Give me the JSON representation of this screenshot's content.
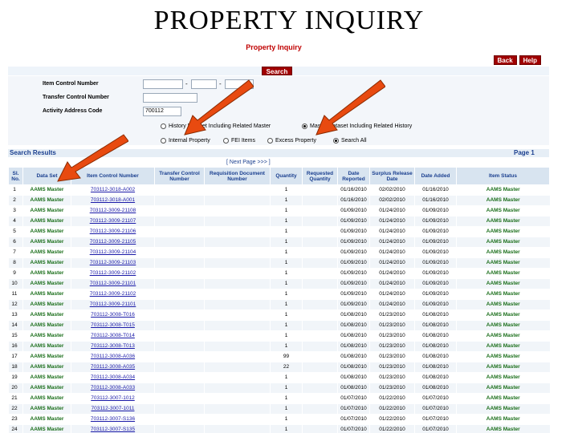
{
  "slide_title": "PROPERTY INQUIRY",
  "page_heading": "Property Inquiry",
  "buttons": {
    "back": "Back",
    "help": "Help",
    "search": "Search"
  },
  "form": {
    "item_control_label": "Item Control Number",
    "transfer_control_label": "Transfer Control Number",
    "aac_label": "Activity Address Code",
    "aac_value": "700112",
    "radio_history": "History Dataset Including Related Master",
    "radio_master": "Master Dataset Including Related History",
    "radio_internal": "Internal Property",
    "radio_fei": "FEI Items",
    "radio_excess": "Excess Property",
    "radio_search_all": "Search All"
  },
  "results": {
    "label": "Search Results",
    "page_label": "Page 1",
    "next_page": "[ Next Page >>> ]",
    "columns": [
      "Sl. No.",
      "Data Set",
      "Item Control Number",
      "Transfer Control Number",
      "Requisition Document Number",
      "Quantity",
      "Requested Quantity",
      "Date Reported",
      "Surplus Release Date",
      "Date Added",
      "Item Status"
    ],
    "rows": [
      {
        "no": "1",
        "ds": "AAMS Master",
        "icn": "703112-3018-A002",
        "qty": "1",
        "rep": "01/16/2010",
        "rel": "02/02/2010",
        "added": "01/16/2010",
        "status": "AAMS Master"
      },
      {
        "no": "2",
        "ds": "AAMS Master",
        "icn": "703112-3018-A001",
        "qty": "1",
        "rep": "01/16/2010",
        "rel": "02/02/2010",
        "added": "01/16/2010",
        "status": "AAMS Master"
      },
      {
        "no": "3",
        "ds": "AAMS Master",
        "icn": "703112-3009-21108",
        "qty": "1",
        "rep": "01/09/2010",
        "rel": "01/24/2010",
        "added": "01/09/2010",
        "status": "AAMS Master"
      },
      {
        "no": "4",
        "ds": "AAMS Master",
        "icn": "703112-3009-21107",
        "qty": "1",
        "rep": "01/09/2010",
        "rel": "01/24/2010",
        "added": "01/09/2010",
        "status": "AAMS Master"
      },
      {
        "no": "5",
        "ds": "AAMS Master",
        "icn": "703112-3009-21106",
        "qty": "1",
        "rep": "01/09/2010",
        "rel": "01/24/2010",
        "added": "01/09/2010",
        "status": "AAMS Master"
      },
      {
        "no": "6",
        "ds": "AAMS Master",
        "icn": "703112-3009-21105",
        "qty": "1",
        "rep": "01/09/2010",
        "rel": "01/24/2010",
        "added": "01/09/2010",
        "status": "AAMS Master"
      },
      {
        "no": "7",
        "ds": "AAMS Master",
        "icn": "703112-3009-21104",
        "qty": "1",
        "rep": "01/09/2010",
        "rel": "01/24/2010",
        "added": "01/09/2010",
        "status": "AAMS Master"
      },
      {
        "no": "8",
        "ds": "AAMS Master",
        "icn": "703112-3009-21103",
        "qty": "1",
        "rep": "01/09/2010",
        "rel": "01/24/2010",
        "added": "01/09/2010",
        "status": "AAMS Master"
      },
      {
        "no": "9",
        "ds": "AAMS Master",
        "icn": "703112-3009-21102",
        "qty": "1",
        "rep": "01/09/2010",
        "rel": "01/24/2010",
        "added": "01/09/2010",
        "status": "AAMS Master"
      },
      {
        "no": "10",
        "ds": "AAMS Master",
        "icn": "703112-3009-21101",
        "qty": "1",
        "rep": "01/09/2010",
        "rel": "01/24/2010",
        "added": "01/09/2010",
        "status": "AAMS Master"
      },
      {
        "no": "11",
        "ds": "AAMS Master",
        "icn": "703112-3009-21102",
        "qty": "1",
        "rep": "01/09/2010",
        "rel": "01/24/2010",
        "added": "01/09/2010",
        "status": "AAMS Master"
      },
      {
        "no": "12",
        "ds": "AAMS Master",
        "icn": "703112-3009-21101",
        "qty": "1",
        "rep": "01/09/2010",
        "rel": "01/24/2010",
        "added": "01/09/2010",
        "status": "AAMS Master"
      },
      {
        "no": "13",
        "ds": "AAMS Master",
        "icn": "703112-3008-T016",
        "qty": "1",
        "rep": "01/08/2010",
        "rel": "01/23/2010",
        "added": "01/08/2010",
        "status": "AAMS Master"
      },
      {
        "no": "14",
        "ds": "AAMS Master",
        "icn": "703112-3008-T015",
        "qty": "1",
        "rep": "01/08/2010",
        "rel": "01/23/2010",
        "added": "01/08/2010",
        "status": "AAMS Master"
      },
      {
        "no": "15",
        "ds": "AAMS Master",
        "icn": "703112-3008-T014",
        "qty": "1",
        "rep": "01/08/2010",
        "rel": "01/23/2010",
        "added": "01/08/2010",
        "status": "AAMS Master"
      },
      {
        "no": "16",
        "ds": "AAMS Master",
        "icn": "703112-3008-T013",
        "qty": "1",
        "rep": "01/08/2010",
        "rel": "01/23/2010",
        "added": "01/08/2010",
        "status": "AAMS Master"
      },
      {
        "no": "17",
        "ds": "AAMS Master",
        "icn": "703112-3008-A036",
        "qty": "99",
        "rep": "01/08/2010",
        "rel": "01/23/2010",
        "added": "01/08/2010",
        "status": "AAMS Master"
      },
      {
        "no": "18",
        "ds": "AAMS Master",
        "icn": "703112-3008-A035",
        "qty": "22",
        "rep": "01/08/2010",
        "rel": "01/23/2010",
        "added": "01/08/2010",
        "status": "AAMS Master"
      },
      {
        "no": "19",
        "ds": "AAMS Master",
        "icn": "703112-3008-A034",
        "qty": "1",
        "rep": "01/08/2010",
        "rel": "01/23/2010",
        "added": "01/08/2010",
        "status": "AAMS Master"
      },
      {
        "no": "20",
        "ds": "AAMS Master",
        "icn": "703112-3008-A033",
        "qty": "1",
        "rep": "01/08/2010",
        "rel": "01/23/2010",
        "added": "01/08/2010",
        "status": "AAMS Master"
      },
      {
        "no": "21",
        "ds": "AAMS Master",
        "icn": "703112-3007-1012",
        "qty": "1",
        "rep": "01/07/2010",
        "rel": "01/22/2010",
        "added": "01/07/2010",
        "status": "AAMS Master"
      },
      {
        "no": "22",
        "ds": "AAMS Master",
        "icn": "703112-3007-1011",
        "qty": "1",
        "rep": "01/07/2010",
        "rel": "01/22/2010",
        "added": "01/07/2010",
        "status": "AAMS Master"
      },
      {
        "no": "23",
        "ds": "AAMS Master",
        "icn": "703112-3007-S136",
        "qty": "1",
        "rep": "01/07/2010",
        "rel": "01/22/2010",
        "added": "01/07/2010",
        "status": "AAMS Master"
      },
      {
        "no": "24",
        "ds": "AAMS Master",
        "icn": "703112-3007-S135",
        "qty": "1",
        "rep": "01/07/2010",
        "rel": "01/22/2010",
        "added": "01/07/2010",
        "status": "AAMS Master"
      }
    ]
  },
  "colors": {
    "accent_red": "#a00000",
    "header_blue": "#1a3f8f",
    "dataset_green": "#1a6e1a",
    "link_blue": "#1a1aa8",
    "arrow_orange": "#e84a10"
  },
  "icons": [
    "arrow-annotation-icon"
  ]
}
